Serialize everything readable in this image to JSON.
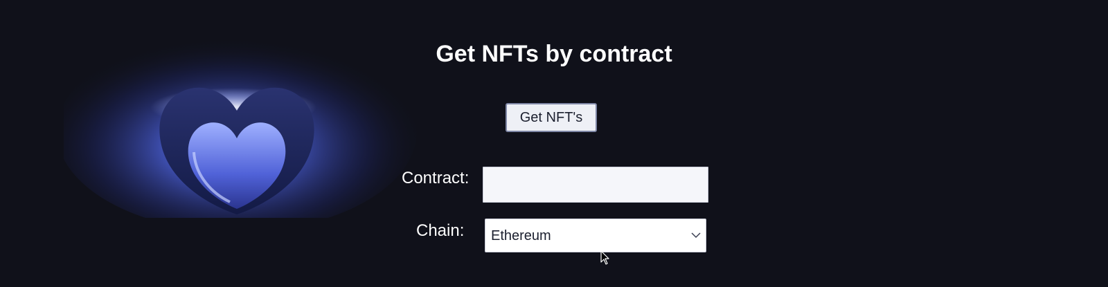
{
  "page": {
    "title": "Get NFTs by contract"
  },
  "actions": {
    "get_button_label": "Get NFT's"
  },
  "form": {
    "contract_label": "Contract:",
    "contract_value": "",
    "chain_label": "Chain:",
    "chain_selected": "Ethereum"
  },
  "colors": {
    "background": "#10111a",
    "text": "#ffffff",
    "accent_glow": "#5b6fe8"
  },
  "icons": {
    "hero": "glowing-heart-icon",
    "dropdown": "chevron-down-icon",
    "pointer": "mouse-cursor-icon"
  }
}
